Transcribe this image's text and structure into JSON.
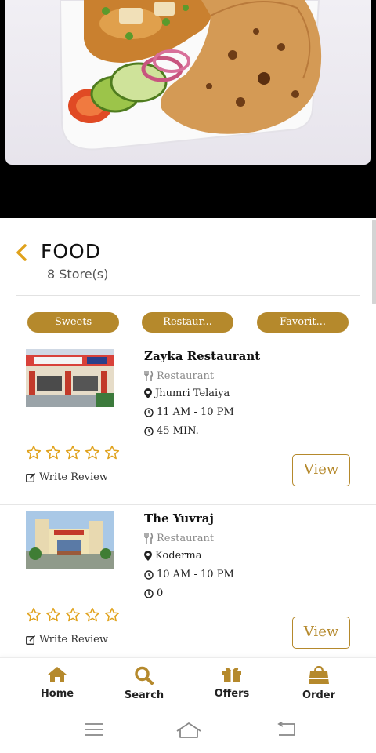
{
  "header": {
    "title": "FOOD",
    "subtitle": "8 Store(s)"
  },
  "chips": [
    {
      "label": "Sweets"
    },
    {
      "label": "Restaur..."
    },
    {
      "label": "Favorit..."
    }
  ],
  "stores": [
    {
      "name": "Zayka Restaurant",
      "category": "Restaurant",
      "location": "Jhumri Telaiya",
      "hours": "11 AM - 10 PM",
      "delivery_time": "45 MIN.",
      "rating": 0,
      "review_label": "Write Review",
      "view_label": "View"
    },
    {
      "name": "The Yuvraj",
      "category": "Restaurant",
      "location": "Koderma",
      "hours": "10 AM - 10 PM",
      "delivery_time": "0",
      "rating": 0,
      "review_label": "Write Review",
      "view_label": "View"
    }
  ],
  "nav": [
    {
      "label": "Home",
      "icon": "home-icon"
    },
    {
      "label": "Search",
      "icon": "search-icon"
    },
    {
      "label": "Offers",
      "icon": "gift-icon"
    },
    {
      "label": "Order",
      "icon": "shopping-bag-icon"
    }
  ],
  "colors": {
    "accent": "#b5892c",
    "star": "#e0a21c",
    "text": "#222222",
    "muted": "#8a8a8a"
  }
}
